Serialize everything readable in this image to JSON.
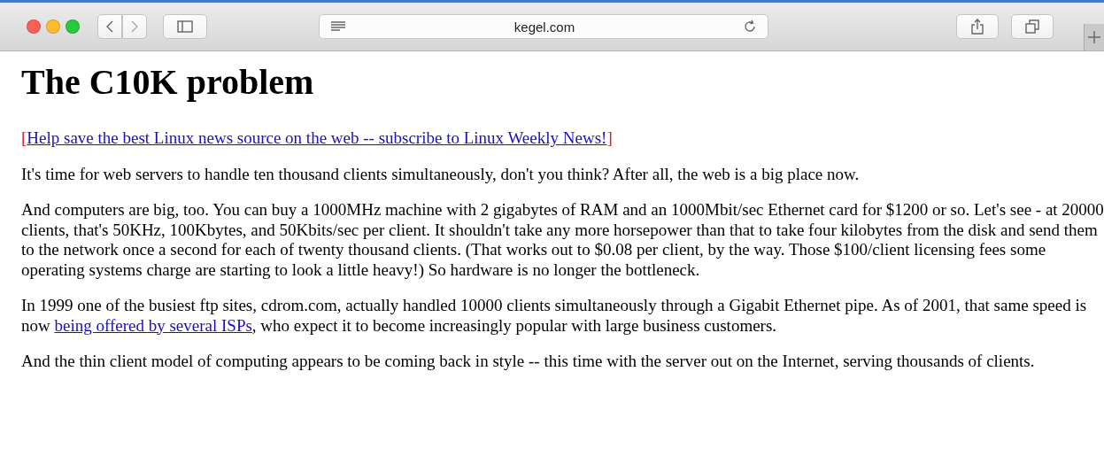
{
  "toolbar": {
    "address": "kegel.com"
  },
  "page": {
    "heading": "The C10K problem",
    "paragraphs": [
      {
        "parts": [
          {
            "kind": "bracket",
            "text": "["
          },
          {
            "kind": "link",
            "text": "Help save the best Linux news source on the web -- subscribe to Linux Weekly News!"
          },
          {
            "kind": "bracket",
            "text": "]"
          }
        ]
      },
      {
        "parts": [
          {
            "kind": "text",
            "text": "It's time for web servers to handle ten thousand clients simultaneously, don't you think? After all, the web is a big place now."
          }
        ]
      },
      {
        "parts": [
          {
            "kind": "text",
            "text": "And computers are big, too. You can buy a 1000MHz machine with 2 gigabytes of RAM and an 1000Mbit/sec Ethernet card for $1200 or so. Let's see - at 20000 clients, that's 50KHz, 100Kbytes, and 50Kbits/sec per client. It shouldn't take any more horsepower than that to take four kilobytes from the disk and send them to the network once a second for each of twenty thousand clients. (That works out to $0.08 per client, by the way. Those $100/client licensing fees some operating systems charge are starting to look a little heavy!) So hardware is no longer the bottleneck."
          }
        ]
      },
      {
        "parts": [
          {
            "kind": "text",
            "text": "In 1999 one of the busiest ftp sites, cdrom.com, actually handled 10000 clients simultaneously through a Gigabit Ethernet pipe. As of 2001, that same speed is now "
          },
          {
            "kind": "link",
            "text": "being offered by several ISPs"
          },
          {
            "kind": "text",
            "text": ", who expect it to become increasingly popular with large business customers."
          }
        ]
      },
      {
        "parts": [
          {
            "kind": "text",
            "text": "And the thin client model of computing appears to be coming back in style -- this time with the server out on the Internet, serving thousands of clients."
          }
        ]
      }
    ]
  }
}
